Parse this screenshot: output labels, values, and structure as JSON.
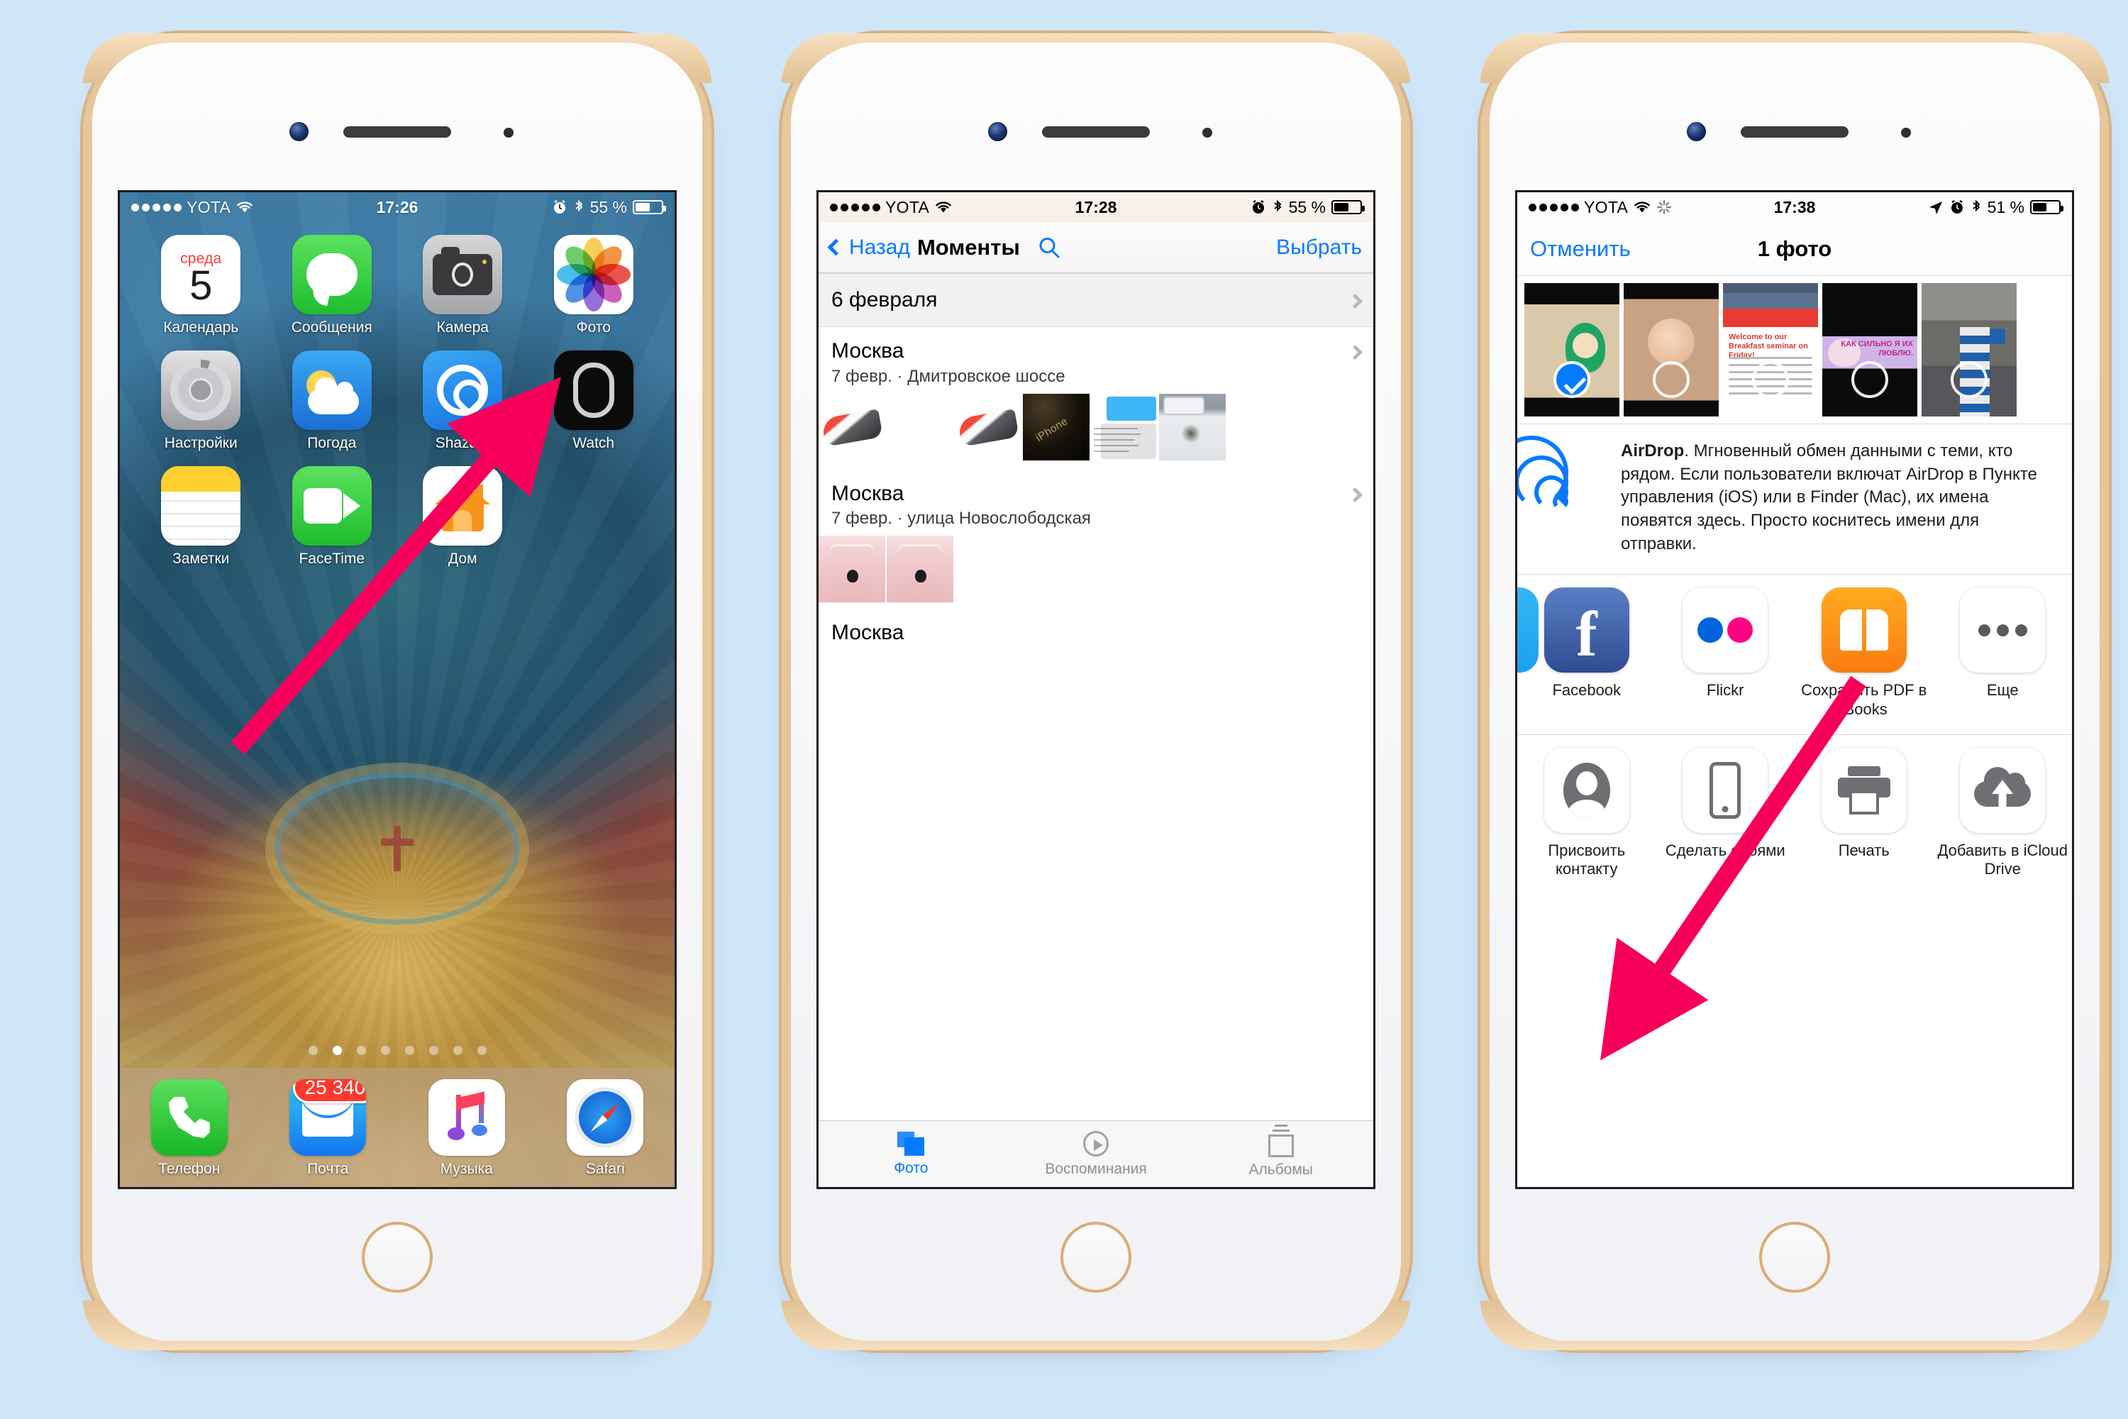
{
  "background_color": "#cfe6f9",
  "accent_color": "#067aff",
  "arrow_color": "#f6005c",
  "phones": {
    "phone1": {
      "name": "iPhone home screen",
      "status_bar": {
        "signal_dots": 5,
        "carrier": "YOTA",
        "wifi": "wifi-icon",
        "time": "17:26",
        "alarm": "alarm-icon",
        "bluetooth": "bluetooth-icon",
        "battery_percent": "55 %",
        "battery_level": 55
      },
      "apps": [
        {
          "label": "Календарь",
          "icon": "calendar-icon",
          "weekday": "среда",
          "day": "5"
        },
        {
          "label": "Сообщения",
          "icon": "messages-icon"
        },
        {
          "label": "Камера",
          "icon": "camera-icon"
        },
        {
          "label": "Фото",
          "icon": "photos-icon"
        },
        {
          "label": "Настройки",
          "icon": "settings-icon"
        },
        {
          "label": "Погода",
          "icon": "weather-icon"
        },
        {
          "label": "Shazam",
          "icon": "shazam-icon"
        },
        {
          "label": "Watch",
          "icon": "watch-icon"
        },
        {
          "label": "Заметки",
          "icon": "notes-icon"
        },
        {
          "label": "FaceTime",
          "icon": "facetime-icon"
        },
        {
          "label": "Дом",
          "icon": "home-app-icon"
        }
      ],
      "page_dots": {
        "count": 8,
        "active_index": 1
      },
      "dock": [
        {
          "label": "Телефон",
          "icon": "phone-icon"
        },
        {
          "label": "Почта",
          "icon": "mail-icon",
          "badge": "25 340"
        },
        {
          "label": "Музыка",
          "icon": "music-icon"
        },
        {
          "label": "Safari",
          "icon": "safari-icon"
        }
      ]
    },
    "phone2": {
      "name": "Photos Moments list",
      "status_bar": {
        "signal_dots": 5,
        "carrier": "YOTA",
        "wifi": "wifi-icon",
        "time": "17:28",
        "alarm": "alarm-icon",
        "bluetooth": "bluetooth-icon",
        "battery_percent": "55 %",
        "battery_level": 55
      },
      "navbar": {
        "back_label": "Назад",
        "title": "Моменты",
        "search_icon": "search-icon",
        "select_label": "Выбрать"
      },
      "moments": [
        {
          "title": "6 февраля",
          "subtitle": "",
          "kind": "date-header"
        },
        {
          "title": "Москва",
          "subtitle": "7 февр. · Дмитровское шоссе",
          "kind": "place"
        },
        {
          "title": "Москва",
          "subtitle": "7 февр. · улица Новослободская",
          "kind": "place"
        },
        {
          "title": "Москва",
          "subtitle": "",
          "kind": "place-partial"
        }
      ],
      "tabs": [
        {
          "label": "Фото",
          "icon": "photos-stack-icon",
          "active": true
        },
        {
          "label": "Воспоминания",
          "icon": "memories-icon",
          "active": false
        },
        {
          "label": "Альбомы",
          "icon": "albums-icon",
          "active": false
        }
      ]
    },
    "phone3": {
      "name": "Share sheet",
      "status_bar": {
        "signal_dots": 5,
        "carrier": "YOTA",
        "wifi": "wifi-icon",
        "sync": "sync-icon",
        "time": "17:38",
        "location": "location-arrow-icon",
        "alarm": "alarm-icon",
        "bluetooth": "bluetooth-icon",
        "battery_percent": "51 %",
        "battery_level": 51
      },
      "navbar": {
        "cancel_label": "Отменить",
        "title": "1 фото"
      },
      "thumbnail_count": 5,
      "selected_thumbnail_index": 0,
      "airdrop": {
        "icon": "airdrop-icon",
        "name": "AirDrop",
        "text": ". Мгновенный обмен данными с теми, кто рядом. Если пользователи включат AirDrop в Пункте управления (iOS) или в Finder (Mac), их имена появятся здесь. Просто коснитесь имени для отправки."
      },
      "share_apps": [
        {
          "label": "Facebook",
          "icon": "facebook-icon"
        },
        {
          "label": "Flickr",
          "icon": "flickr-icon"
        },
        {
          "label": "Сохранить PDF в iBooks",
          "icon": "ibooks-icon"
        },
        {
          "label": "Еще",
          "icon": "more-icon"
        }
      ],
      "share_actions": [
        {
          "label": "Присвоить контакту",
          "icon": "contact-icon"
        },
        {
          "label": "Сделать обоями",
          "icon": "wallpaper-icon"
        },
        {
          "label": "Печать",
          "icon": "printer-icon"
        },
        {
          "label": "Добавить в iCloud Drive",
          "icon": "icloud-upload-icon"
        }
      ]
    }
  }
}
